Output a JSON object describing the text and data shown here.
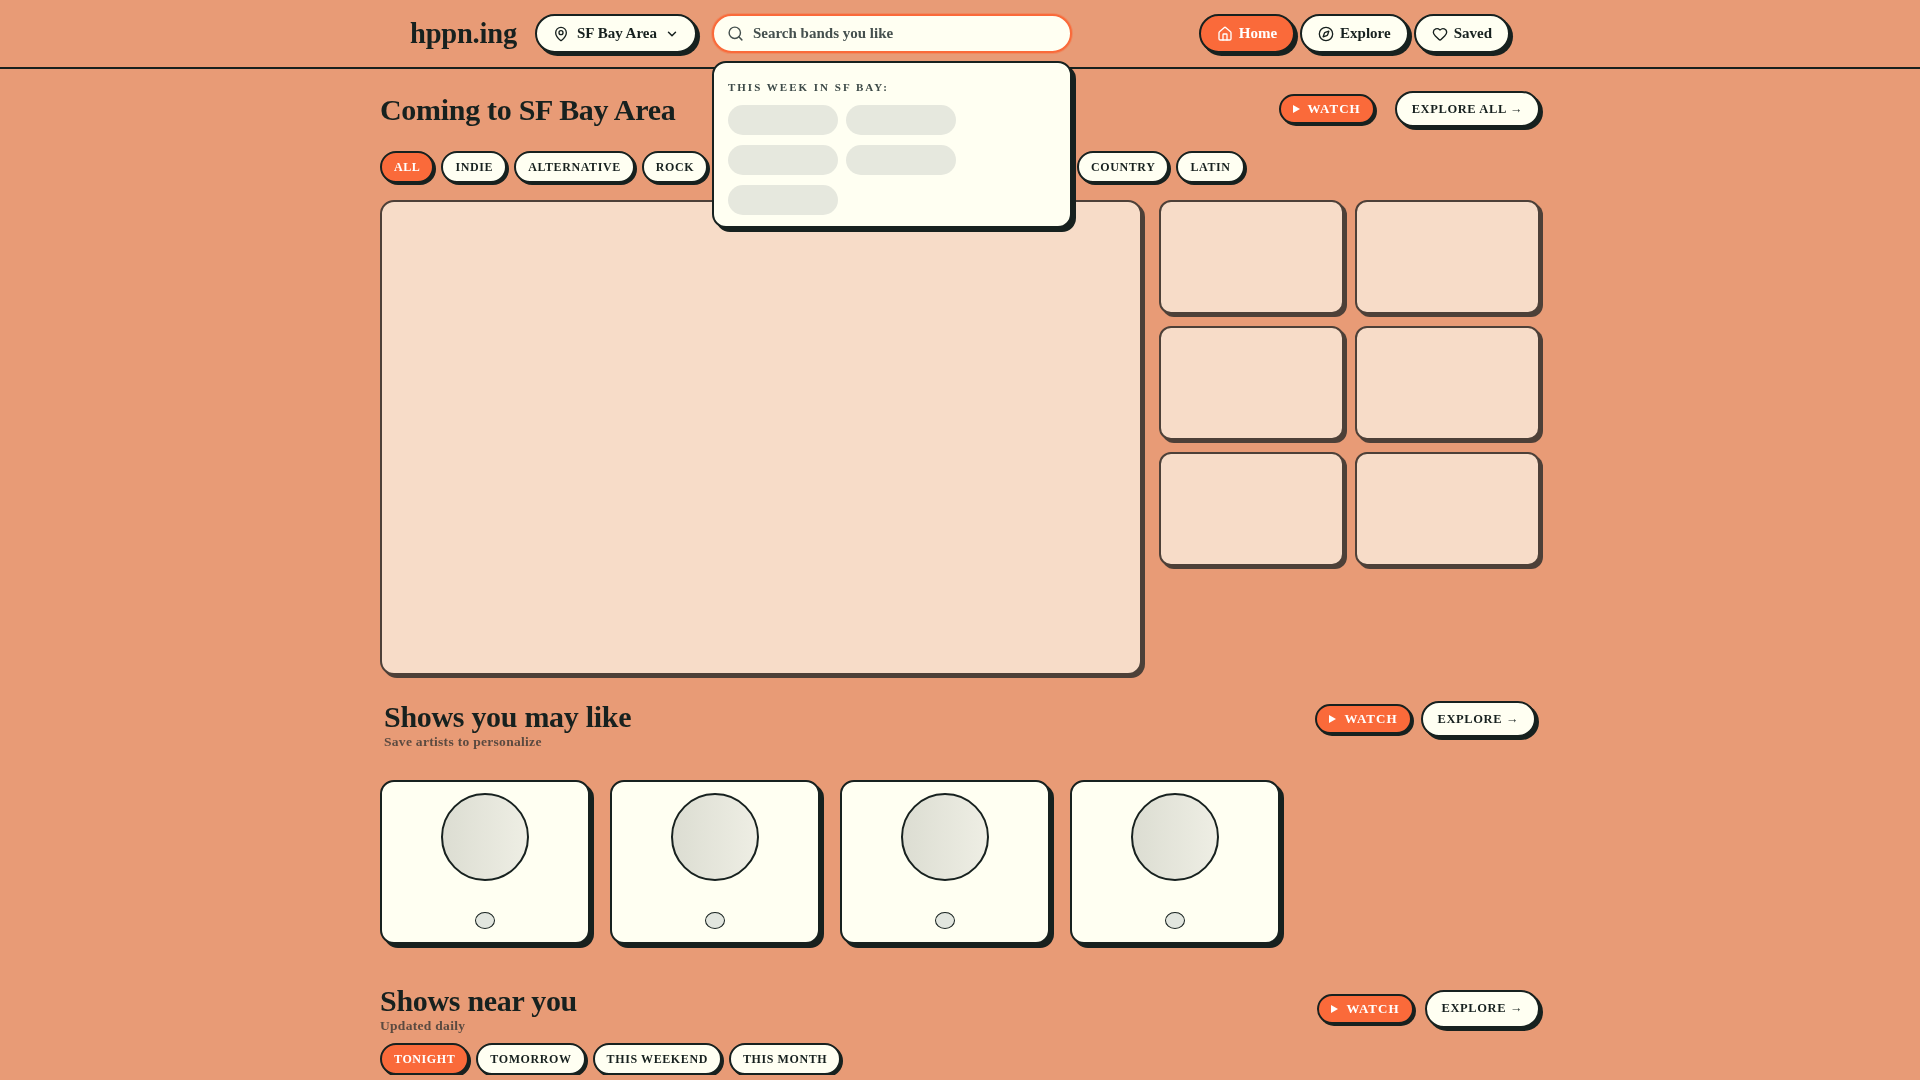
{
  "header": {
    "logo": "hppn.ing",
    "location": {
      "label": "SF Bay Area"
    },
    "search": {
      "placeholder": "Search bands you like",
      "focused": true,
      "dropdown": {
        "heading": "THIS WEEK IN SF BAY:",
        "suggestions": [
          {
            "kind": "skeleton"
          },
          {
            "kind": "skeleton"
          },
          {
            "kind": "skeleton"
          },
          {
            "kind": "skeleton"
          },
          {
            "kind": "skeleton"
          }
        ]
      }
    },
    "nav": [
      {
        "label": "Home",
        "selected": true
      },
      {
        "label": "Explore",
        "selected": false
      },
      {
        "label": "Saved",
        "selected": false
      }
    ]
  },
  "coming_to": {
    "title": "Coming to SF Bay Area",
    "watch": "WATCH",
    "explore": "EXPLORE ALL →",
    "filters": [
      {
        "label": "ALL",
        "selected": true
      },
      {
        "label": "INDIE",
        "selected": false
      },
      {
        "label": "ALTERNATIVE",
        "selected": false
      },
      {
        "label": "ROCK",
        "selected": false
      },
      {
        "label": "COUNTRY",
        "selected": false
      },
      {
        "label": "LATIN",
        "selected": false
      }
    ],
    "tiles": [
      {
        "kind": "large"
      },
      {
        "kind": "small"
      },
      {
        "kind": "small"
      },
      {
        "kind": "small"
      },
      {
        "kind": "small"
      },
      {
        "kind": "small"
      },
      {
        "kind": "small"
      }
    ]
  },
  "shows_you_may_like": {
    "title": "Shows you may like",
    "subtitle": "Save artists to personalize",
    "watch": "WATCH",
    "explore": "EXPLORE →",
    "cards": [
      {
        "kind": "skeleton"
      },
      {
        "kind": "skeleton"
      },
      {
        "kind": "skeleton"
      },
      {
        "kind": "skeleton"
      }
    ]
  },
  "shows_near_you": {
    "title": "Shows near you",
    "subtitle": "Updated daily",
    "watch": "WATCH",
    "explore": "EXPLORE →",
    "filters": [
      {
        "label": "TONIGHT",
        "selected": true
      },
      {
        "label": "TOMORROW",
        "selected": false
      },
      {
        "label": "THIS WEEKEND",
        "selected": false
      },
      {
        "label": "THIS MONTH",
        "selected": false
      }
    ]
  }
}
